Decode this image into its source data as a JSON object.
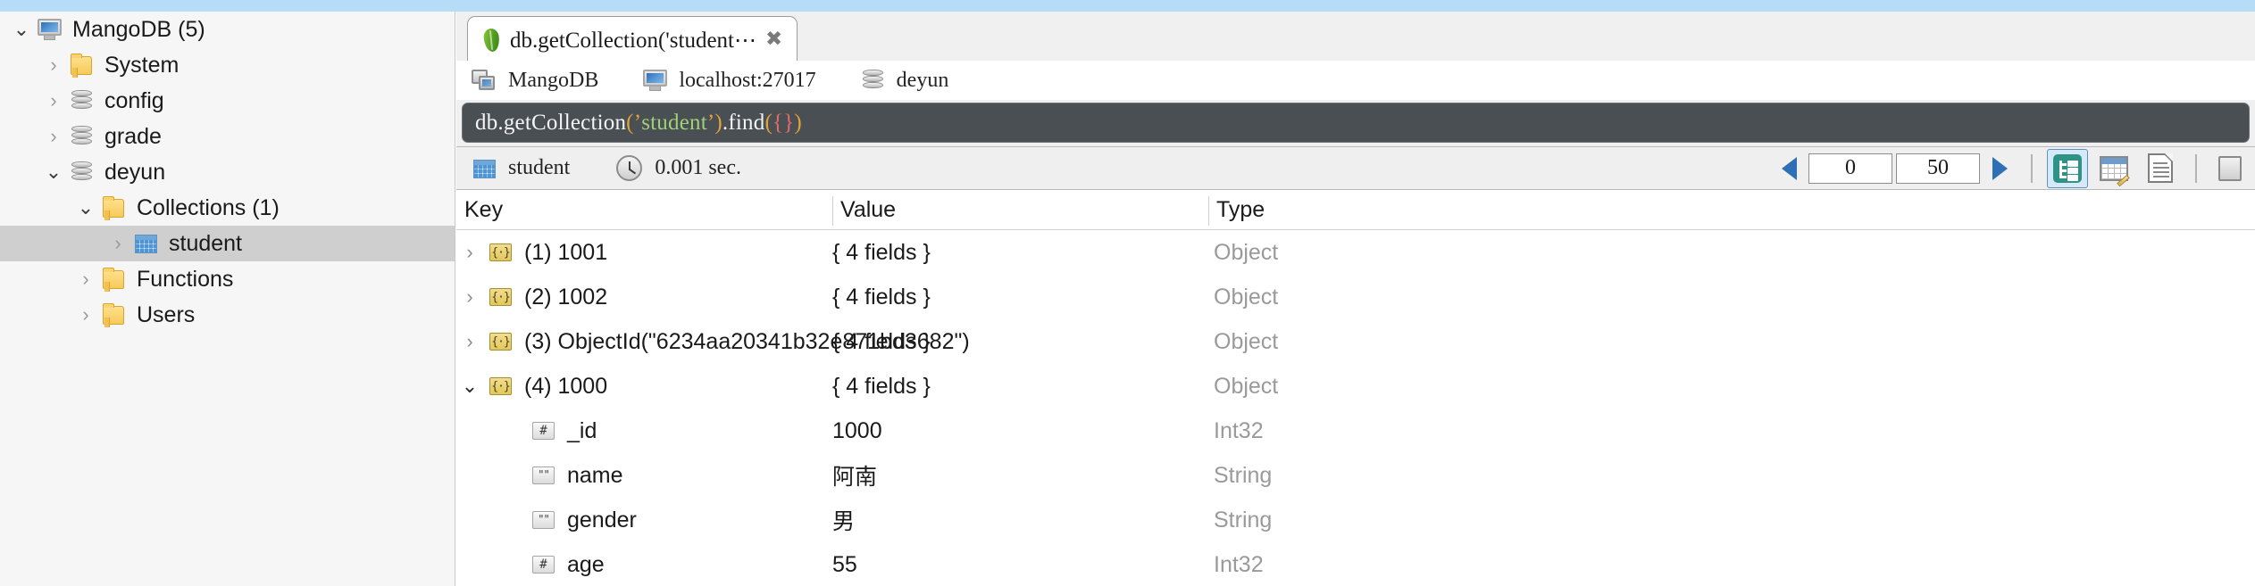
{
  "window": {
    "accent_blue": "#b6dcf7"
  },
  "sidebar": {
    "items": [
      {
        "label": "MangoDB (5)",
        "icon": "monitor-icon",
        "twisty": "open",
        "depth": 0,
        "selected": false
      },
      {
        "label": "System",
        "icon": "folder-icon",
        "twisty": "collapsed",
        "depth": 1,
        "selected": false
      },
      {
        "label": "config",
        "icon": "database-icon",
        "twisty": "collapsed",
        "depth": 1,
        "selected": false
      },
      {
        "label": "grade",
        "icon": "database-icon",
        "twisty": "collapsed",
        "depth": 1,
        "selected": false
      },
      {
        "label": "deyun",
        "icon": "database-icon",
        "twisty": "open",
        "depth": 1,
        "selected": false
      },
      {
        "label": "Collections (1)",
        "icon": "folder-icon",
        "twisty": "open",
        "depth": 2,
        "selected": false
      },
      {
        "label": "student",
        "icon": "collection-icon",
        "twisty": "collapsed",
        "depth": 3,
        "selected": true
      },
      {
        "label": "Functions",
        "icon": "folder-icon",
        "twisty": "collapsed",
        "depth": 2,
        "selected": false
      },
      {
        "label": "Users",
        "icon": "folder-icon",
        "twisty": "collapsed",
        "depth": 2,
        "selected": false
      }
    ]
  },
  "tab": {
    "title": "db.getCollection('student⋯",
    "icon": "mongodb-leaf-icon",
    "close_label": "✖"
  },
  "connection": {
    "server": "MangoDB",
    "host": "localhost:27017",
    "database": "deyun"
  },
  "query": {
    "prefix": "db.getCollection",
    "open_paren": "(",
    "quote_open": "’",
    "string": "student",
    "quote_close": "’",
    "close_paren": ")",
    "method": ".find",
    "open_paren2": "(",
    "braces": "{}",
    "close_paren2": ")",
    "full_text": "db.getCollection('student').find({})"
  },
  "toolbar": {
    "collection_name": "student",
    "collection_icon": "collection-icon",
    "clock_icon": "clock-icon",
    "elapsed": "0.001 sec.",
    "prev_label": "◀",
    "next_label": "▶",
    "skip_value": "0",
    "limit_value": "50",
    "view_buttons": [
      {
        "name": "tree-view",
        "icon": "tree-view-icon",
        "active": true
      },
      {
        "name": "table-view",
        "icon": "table-edit-icon",
        "active": false
      },
      {
        "name": "text-view",
        "icon": "document-icon",
        "active": false
      },
      {
        "name": "copy-view",
        "icon": "clipboard-icon",
        "active": false
      }
    ]
  },
  "results": {
    "columns": [
      "Key",
      "Value",
      "Type"
    ],
    "rows": [
      {
        "key": "(1) 1001",
        "value": "{ 4 fields }",
        "type": "Object",
        "icon": "object-icon",
        "twisty": "collapsed",
        "indent": 0
      },
      {
        "key": "(2) 1002",
        "value": "{ 4 fields }",
        "type": "Object",
        "icon": "object-icon",
        "twisty": "collapsed",
        "indent": 0
      },
      {
        "key": "(3) ObjectId(\"6234aa20341b32e871bd3682\")",
        "value": "{ 4 fields }",
        "type": "Object",
        "icon": "object-icon",
        "twisty": "collapsed",
        "indent": 0
      },
      {
        "key": "(4) 1000",
        "value": "{ 4 fields }",
        "type": "Object",
        "icon": "object-icon",
        "twisty": "open",
        "indent": 0
      },
      {
        "key": "_id",
        "value": "1000",
        "type": "Int32",
        "icon": "int-icon",
        "twisty": "none",
        "indent": 1
      },
      {
        "key": "name",
        "value": "阿南",
        "type": "String",
        "icon": "string-icon",
        "twisty": "none",
        "indent": 1
      },
      {
        "key": "gender",
        "value": "男",
        "type": "String",
        "icon": "string-icon",
        "twisty": "none",
        "indent": 1
      },
      {
        "key": "age",
        "value": "55",
        "type": "Int32",
        "icon": "int-icon",
        "twisty": "none",
        "indent": 1
      }
    ]
  },
  "glyphs": {
    "twisty_collapsed": "›",
    "twisty_open": "⌄",
    "object_icon_text": "{·}",
    "int_icon_text": "#",
    "string_icon_text": "\"\""
  }
}
